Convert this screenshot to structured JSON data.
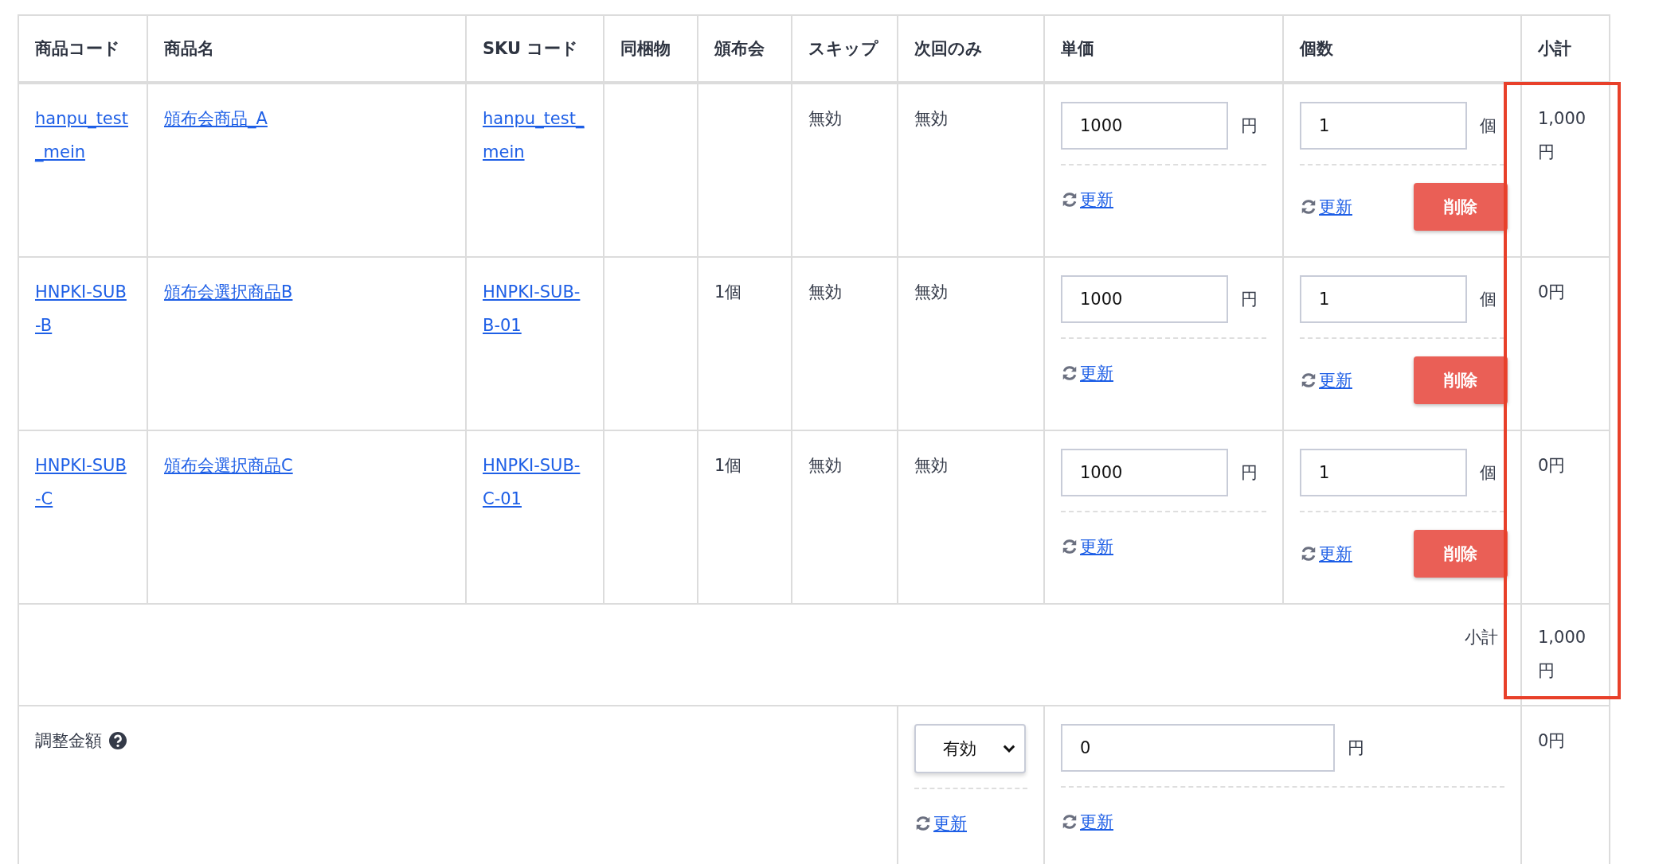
{
  "columns": [
    "商品コード",
    "商品名",
    "SKU コード",
    "同梱物",
    "頒布会",
    "スキップ",
    "次回のみ",
    "単価",
    "個数",
    "小計"
  ],
  "rows": [
    {
      "code": "hanpu_test_mein",
      "name": "頒布会商品_A",
      "sku": "hanpu_test_mein",
      "skip": "無効",
      "next_only": "無効",
      "unit_price": "1000",
      "price_unit": "円",
      "price_update": "更新",
      "qty": "1",
      "qty_unit": "個",
      "qty_update": "更新",
      "delete": "削除",
      "subtotal": "1,000円"
    },
    {
      "code": "HNPKI-SUB-B",
      "name": "頒布会選択商品B",
      "sku": "HNPKI-SUB-B-01",
      "hanpukai": "1個",
      "skip": "無効",
      "next_only": "無効",
      "unit_price": "1000",
      "price_unit": "円",
      "price_update": "更新",
      "qty": "1",
      "qty_unit": "個",
      "qty_update": "更新",
      "delete": "削除",
      "subtotal": "0円"
    },
    {
      "code": "HNPKI-SUB-C",
      "name": "頒布会選択商品C",
      "sku": "HNPKI-SUB-C-01",
      "hanpukai": "1個",
      "skip": "無効",
      "next_only": "無効",
      "unit_price": "1000",
      "price_unit": "円",
      "price_update": "更新",
      "qty": "1",
      "qty_unit": "個",
      "qty_update": "更新",
      "delete": "削除",
      "subtotal": "0円"
    }
  ],
  "subtotal_row": {
    "label": "小計",
    "value": "1,000円"
  },
  "adjustment": {
    "label": "調整金額",
    "select": "有効",
    "select_update": "更新",
    "amount": "0",
    "amount_unit": "円",
    "amount_update": "更新",
    "subtotal": "0円"
  }
}
